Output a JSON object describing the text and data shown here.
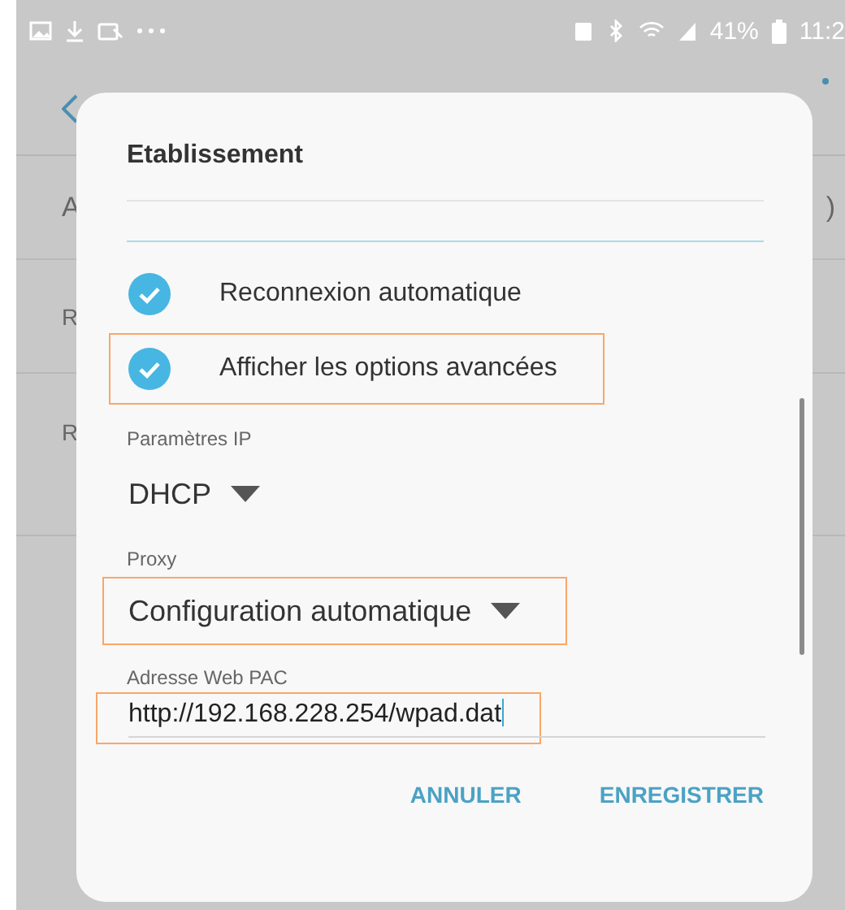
{
  "status_bar": {
    "battery": "41%",
    "time": "11:2"
  },
  "background": {
    "fragments": [
      {
        "text": "A"
      },
      {
        "text": "R"
      },
      {
        "text": "R"
      }
    ],
    "edge_text": ")"
  },
  "dialog": {
    "title": "Etablissement",
    "options": [
      {
        "label": "Reconnexion automatique",
        "checked": true,
        "highlighted": false
      },
      {
        "label": "Afficher les options avancées",
        "checked": true,
        "highlighted": true
      }
    ],
    "ip_settings": {
      "label": "Paramètres IP",
      "value": "DHCP",
      "highlighted": false
    },
    "proxy": {
      "label": "Proxy",
      "value": "Configuration automatique",
      "highlighted": true
    },
    "pac": {
      "label": "Adresse Web PAC",
      "value": "http://192.168.228.254/wpad.dat",
      "highlighted": true
    },
    "buttons": [
      "ANNULER",
      "ENREGISTRER"
    ]
  }
}
